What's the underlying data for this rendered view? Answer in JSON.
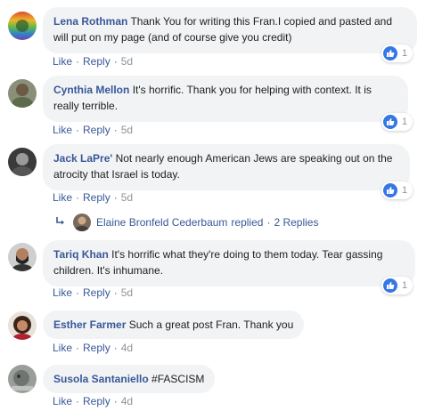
{
  "comments": [
    {
      "author": "Lena Rothman",
      "text": "Thank You for writing this Fran.I copied and pasted and will put on my page (and of course give you credit)",
      "like": "Like",
      "reply": "Reply",
      "time": "5d",
      "reactions": "1"
    },
    {
      "author": "Cynthia Mellon",
      "text": "It's horrific. Thank you for helping with context. It is really terrible.",
      "like": "Like",
      "reply": "Reply",
      "time": "5d",
      "reactions": "1"
    },
    {
      "author": "Jack LaPre'",
      "text": "Not nearly enough American Jews are speaking out on the atrocity that Israel is today.",
      "like": "Like",
      "reply": "Reply",
      "time": "5d",
      "reactions": "1"
    },
    {
      "author": "Tariq Khan",
      "text": "It's horrific what they're doing to them today. Tear gassing children. It's inhumane.",
      "like": "Like",
      "reply": "Reply",
      "time": "5d",
      "reactions": "1"
    },
    {
      "author": "Esther Farmer",
      "text": "Such a great post Fran. Thank you",
      "like": "Like",
      "reply": "Reply",
      "time": "4d"
    },
    {
      "author": "Susola Santaniello",
      "text": "#FASCISM",
      "like": "Like",
      "reply": "Reply",
      "time": "4d"
    }
  ],
  "replies_row": {
    "name": "Elaine Bronfeld Cederbaum",
    "replied": "replied",
    "sep": "·",
    "count": "2 Replies"
  },
  "colors": {
    "link": "#385898",
    "bubble": "#f2f3f5",
    "like_blue": "#3578e5",
    "meta": "#90949c"
  },
  "icons": {
    "reaction": "like-thumb-icon",
    "reply_arrow": "reply-arrow-icon"
  }
}
